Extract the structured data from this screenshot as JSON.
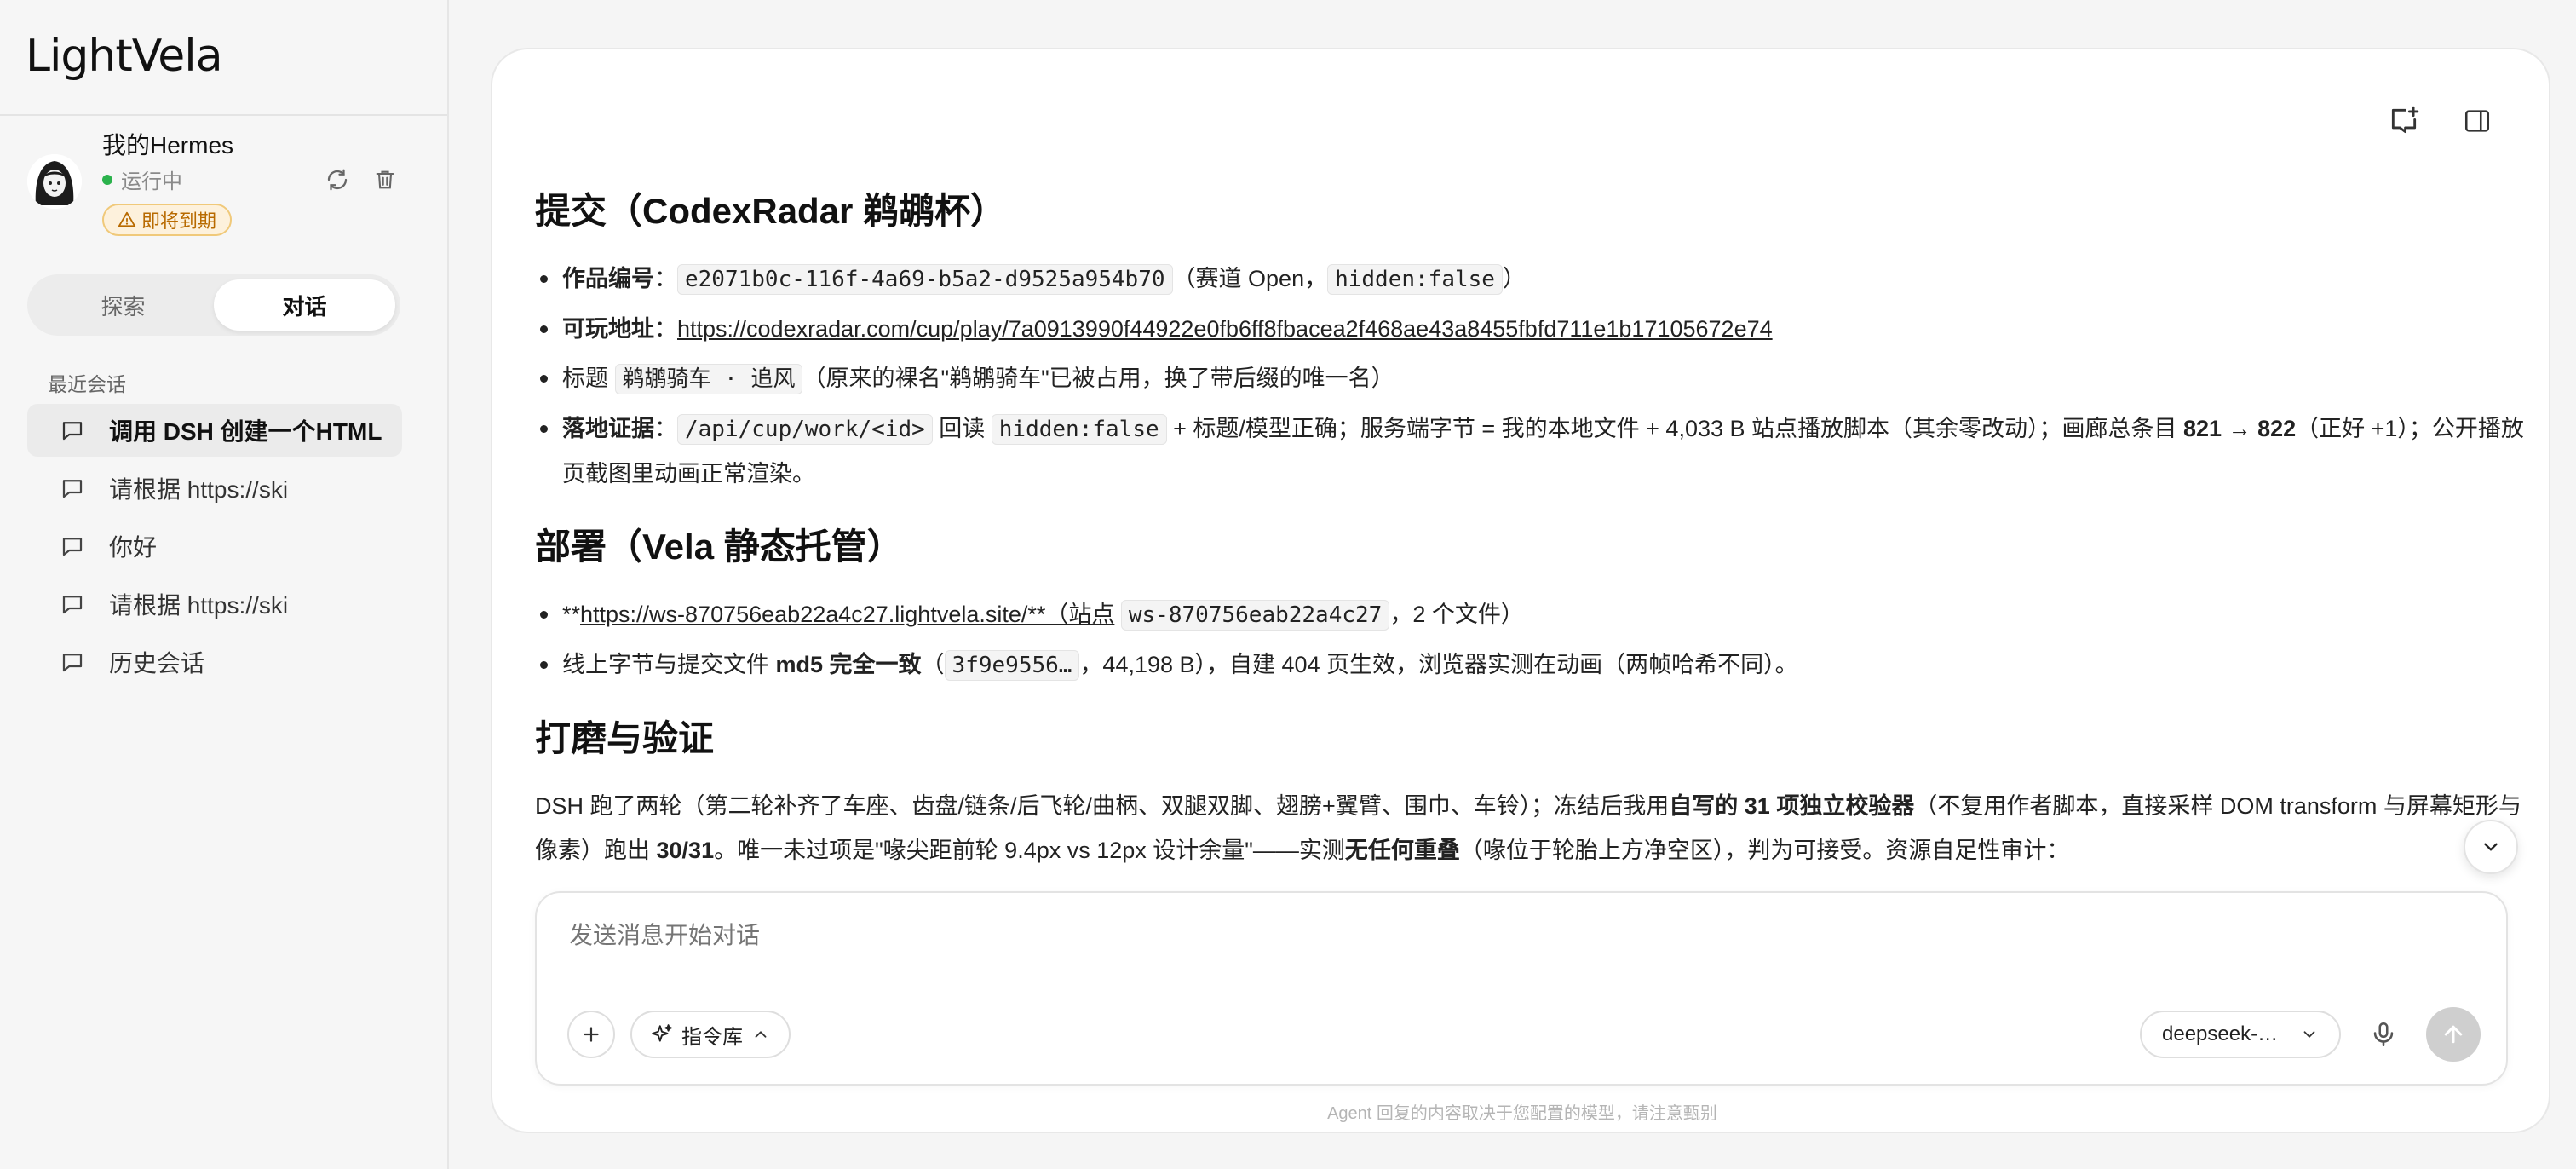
{
  "app": {
    "logo": "LightVela"
  },
  "agent": {
    "name": "我的Hermes",
    "status": "运行中",
    "badge": "即将到期"
  },
  "tabs": {
    "explore": "探索",
    "chat": "对话"
  },
  "sidebar": {
    "recent_label": "最近会话",
    "items": [
      {
        "label": "调用 DSH 创建一个HTML"
      },
      {
        "label": "请根据 https://ski"
      },
      {
        "label": "你好"
      },
      {
        "label": "请根据 https://ski"
      },
      {
        "label": "历史会话"
      }
    ]
  },
  "message": {
    "s1": {
      "heading": "提交（CodexRadar 鹈鹕杯）",
      "b1": {
        "label": "作品编号",
        "sep": "：",
        "code": "e2071b0c-116f-4a69-b5a2-d9525a954b70",
        "mid": "（赛道 Open，",
        "code2": "hidden:false",
        "end": "）"
      },
      "b2": {
        "label": "可玩地址",
        "sep": "：",
        "link": "https://codexradar.com/cup/play/7a0913990f44922e0fb6ff8fbacea2f468ae43a8455fbfd711e1b17105672e74"
      },
      "b3": {
        "pre": "标题 ",
        "code": "鹈鹕骑车 · 追风",
        "post": "（原来的裸名\"鹈鹕骑车\"已被占用，换了带后缀的唯一名）"
      },
      "b4": {
        "label": "落地证据",
        "sep": "：",
        "code": "/api/cup/work/<id>",
        "t1": " 回读 ",
        "code2": "hidden:false",
        "t2": " + 标题/模型正确；服务端字节 = 我的本地文件 + 4,033 B 站点播放脚本（其余零改动）；画廊总条目 ",
        "bold": "821 → 822",
        "t3": "（正好 +1）；公开播放页截图里动画正常渲染。"
      }
    },
    "s2": {
      "heading": "部署（Vela 静态托管）",
      "b1": {
        "pre": "**",
        "link": "https://ws-870756eab22a4c27.lightvela.site/**（站点",
        "sp": " ",
        "code": "ws-870756eab22a4c27",
        "post": "，2 个文件）"
      },
      "b2": {
        "pre": "线上字节与提交文件 ",
        "bold": "md5 完全一致",
        "mid": "（",
        "code": "3f9e9556…",
        "post": "，44,198 B），自建 404 页生效，浏览器实测在动画（两帧哈希不同）。"
      }
    },
    "s3": {
      "heading": "打磨与验证",
      "p": {
        "t1": "DSH 跑了两轮（第二轮补齐了车座、齿盘/链条/后飞轮/曲柄、双腿双脚、翅膀+翼臂、围巾、车铃）；冻结后我用",
        "b1": "自写的 31 项独立校验器",
        "t2": "（不复用作者脚本，直接采样 DOM transform 与屏幕矩形与像素）跑出 ",
        "b2": "30/31",
        "t3": "。唯一未过项是\"喙尖距前轮 9.4px vs 12px 设计余量\"——实测",
        "b3": "无任何重叠",
        "t4": "（喙位于轮胎上方净空区），判为可接受。资源自足性审计："
      }
    }
  },
  "composer": {
    "placeholder": "发送消息开始对话",
    "cmd_label": "指令库",
    "model": "deepseek-…"
  },
  "disclaimer": "Agent 回复的内容取决于您配置的模型，请注意甄别"
}
